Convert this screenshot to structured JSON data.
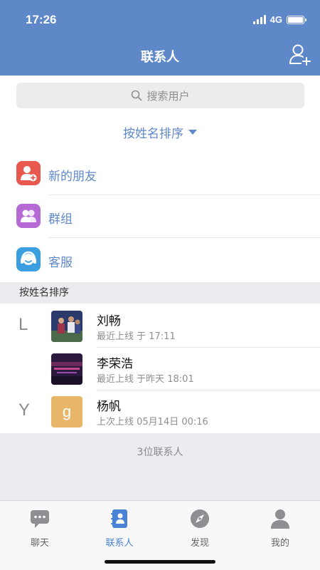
{
  "status_bar": {
    "time": "17:26",
    "network": "4G"
  },
  "nav": {
    "title": "联系人",
    "add_icon": "add-contact-icon"
  },
  "search": {
    "placeholder": "搜索用户",
    "icon": "search-icon"
  },
  "sort": {
    "label": "按姓名排序"
  },
  "menu": [
    {
      "label": "新的朋友",
      "icon": "new-friend-icon",
      "color": "#e8584f"
    },
    {
      "label": "群组",
      "icon": "group-icon",
      "color": "#b56ad6"
    },
    {
      "label": "客服",
      "icon": "customer-service-icon",
      "color": "#3a9ee0"
    }
  ],
  "section_header": "按姓名排序",
  "contacts": [
    {
      "index": "L",
      "name": "刘畅",
      "status": "最近上线 于 17:11",
      "avatar": "photo-avatar"
    },
    {
      "index": "",
      "name": "李荣浩",
      "status": "最近上线 于昨天 18:01",
      "avatar": "photo-avatar"
    },
    {
      "index": "Y",
      "name": "杨帆",
      "status": "上次上线 05月14日 00:16",
      "avatar": "letter-avatar",
      "avatar_letter": "g",
      "avatar_color": "#e8b668"
    }
  ],
  "footer": {
    "count_text": "3位联系人"
  },
  "tabs": [
    {
      "label": "聊天",
      "icon": "chat-icon",
      "active": false
    },
    {
      "label": "联系人",
      "icon": "contacts-icon",
      "active": true
    },
    {
      "label": "发现",
      "icon": "discover-icon",
      "active": false
    },
    {
      "label": "我的",
      "icon": "profile-icon",
      "active": false
    }
  ],
  "colors": {
    "primary": "#5f88c9",
    "tab_active": "#4a82d6",
    "tab_inactive": "#8e8e93"
  }
}
